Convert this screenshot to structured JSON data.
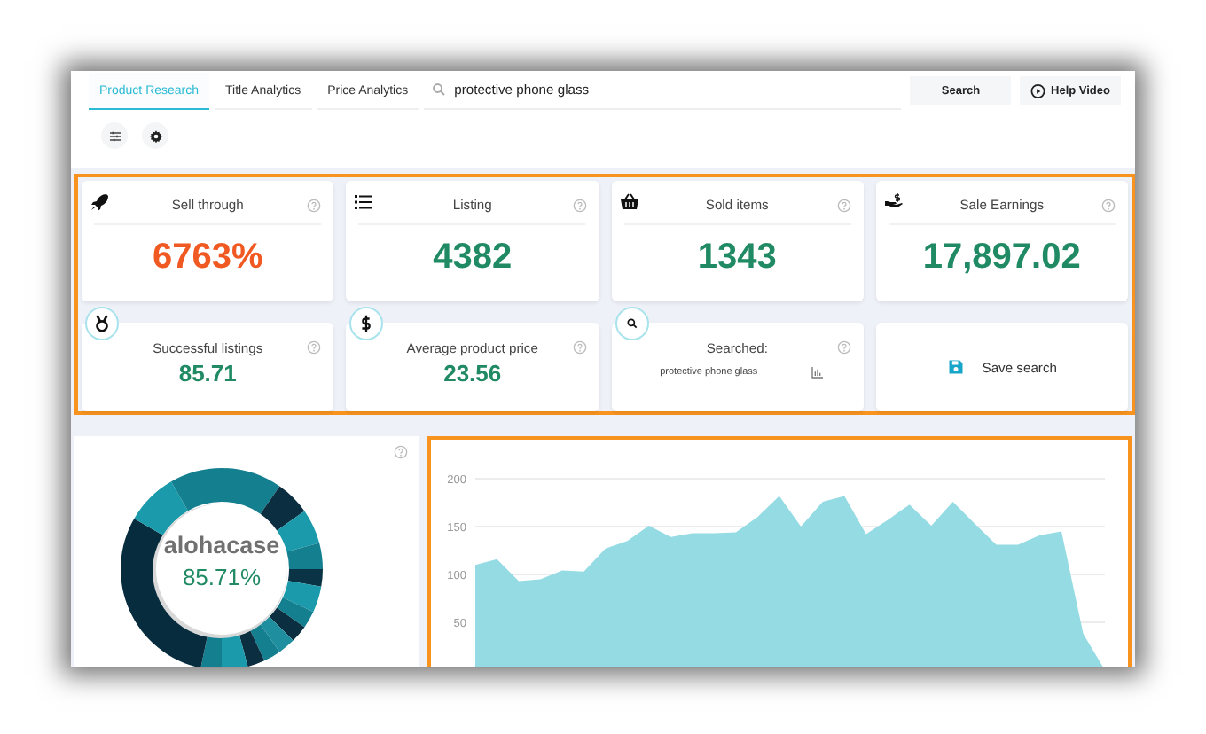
{
  "toolbar": {
    "tabs": [
      {
        "label": "Product Research",
        "selected": true
      },
      {
        "label": "Title Analytics",
        "selected": false
      },
      {
        "label": "Price Analytics",
        "selected": false
      }
    ],
    "search": {
      "value": "protective phone glass"
    },
    "search_button": "Search",
    "help_button": "Help Video"
  },
  "cards": [
    {
      "kind": "metric",
      "title": "Sell through",
      "value": "6763%",
      "color": "#f05a22"
    },
    {
      "kind": "metric",
      "title": "Listing",
      "value": "4382",
      "color": "#1f8a63"
    },
    {
      "kind": "metric",
      "title": "Sold items",
      "value": "1343",
      "color": "#1f8a63"
    },
    {
      "kind": "metric",
      "title": "Sale Earnings",
      "value": "17,897.02",
      "color": "#1f8a63"
    },
    {
      "kind": "stat",
      "title": "Successful listings",
      "value": "85.71",
      "color": "#1f8a63"
    },
    {
      "kind": "stat",
      "title": "Average product price",
      "value": "23.56",
      "color": "#1f8a63"
    },
    {
      "kind": "searched",
      "title": "Searched:",
      "query": "protective phone glass"
    },
    {
      "kind": "action",
      "label": "Save search"
    }
  ],
  "share": {
    "name": "alohacase",
    "percent": "85.71%"
  },
  "trend": {
    "chart_data": {
      "type": "area",
      "grid": true,
      "ylim": [
        0,
        200
      ],
      "yticks": [
        50,
        100,
        150,
        200
      ],
      "values": [
        110,
        116,
        93,
        95,
        104,
        103,
        127,
        135,
        151,
        139,
        143,
        143,
        144,
        160,
        182,
        150,
        176,
        182,
        142,
        157,
        173,
        151,
        176,
        153,
        131,
        131,
        141,
        145,
        38,
        0
      ]
    }
  }
}
